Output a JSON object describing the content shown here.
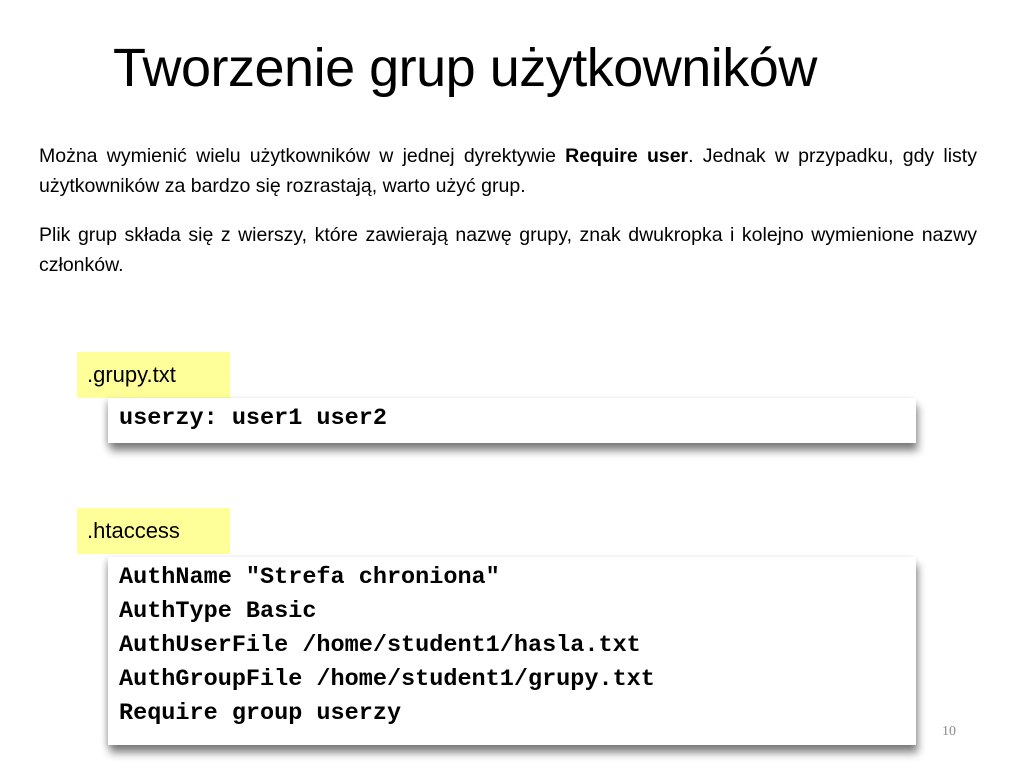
{
  "slide": {
    "title": "Tworzenie grup użytkowników",
    "paragraphs": {
      "p1_before": "Można wymienić wielu użytkowników w jednej dyrektywie ",
      "p1_bold": "Require user",
      "p1_after": ". Jednak w przypadku, gdy listy użytkowników za bardzo się rozrastają, warto użyć grup.",
      "p2": "Plik grup składa się z wierszy, które zawierają nazwę grupy, znak dwukropka i kolejno wymienione nazwy członków."
    },
    "files": [
      {
        "label": ".grupy.txt",
        "lines": [
          "userzy: user1 user2"
        ]
      },
      {
        "label": ".htaccess",
        "lines": [
          "AuthName \"Strefa chroniona\"",
          "AuthType Basic",
          "AuthUserFile /home/student1/hasla.txt",
          "AuthGroupFile /home/student1/grupy.txt",
          "Require group userzy"
        ]
      }
    ],
    "page_number": "10",
    "colors": {
      "label_background": "#ffff99",
      "page_number": "#8a8a8a"
    }
  }
}
